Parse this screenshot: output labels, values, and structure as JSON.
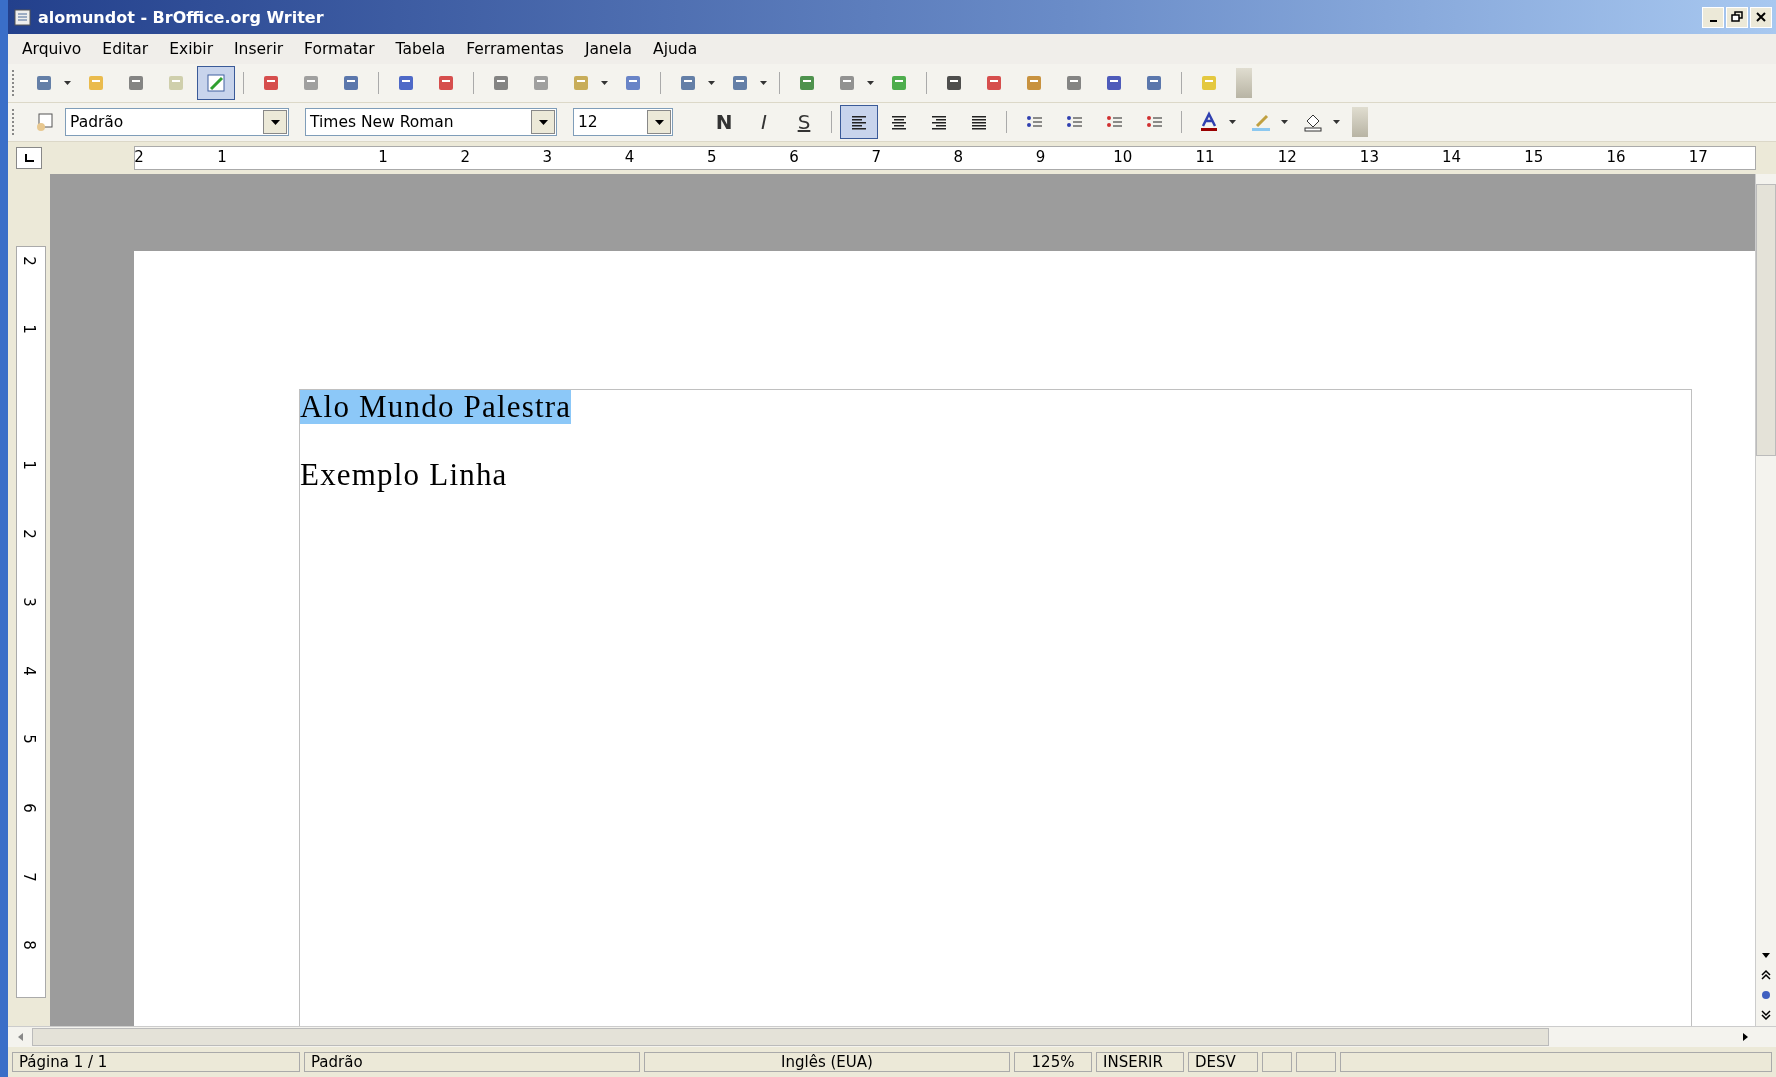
{
  "window": {
    "title": "alomundot - BrOffice.org Writer"
  },
  "menu": [
    "Arquivo",
    "Editar",
    "Exibir",
    "Inserir",
    "Formatar",
    "Tabela",
    "Ferramentas",
    "Janela",
    "Ajuda"
  ],
  "standard_toolbar": {
    "edit_mode_on": true
  },
  "format_toolbar": {
    "style": "Padrão",
    "font": "Times New Roman",
    "size": "12",
    "text_buttons": [
      {
        "label": "N",
        "kind": "bold"
      },
      {
        "label": "I",
        "kind": "italic"
      },
      {
        "label": "S",
        "kind": "underline"
      }
    ],
    "align_buttons": [
      {
        "kind": "left",
        "selected": true
      },
      {
        "kind": "center",
        "selected": false
      },
      {
        "kind": "right",
        "selected": false
      },
      {
        "kind": "justify",
        "selected": false
      }
    ]
  },
  "ruler": {
    "labels": [
      "2",
      "1",
      "1",
      "2",
      "3",
      "4",
      "5",
      "6",
      "7",
      "8",
      "9",
      "10",
      "11",
      "12",
      "13",
      "14",
      "15",
      "16",
      "17"
    ],
    "vertical_labels": [
      "2",
      "1",
      "1",
      "2",
      "3",
      "4",
      "5",
      "6",
      "7",
      "8"
    ]
  },
  "document": {
    "paragraphs": [
      {
        "text": "Alo Mundo Palestra",
        "selected": true
      },
      {
        "text": "Exemplo Linha",
        "selected": false
      }
    ]
  },
  "status_bar": [
    "Página 1 / 1",
    "Padrão",
    "Inglês (EUA)",
    "125%",
    "INSERIR",
    "DESV"
  ]
}
